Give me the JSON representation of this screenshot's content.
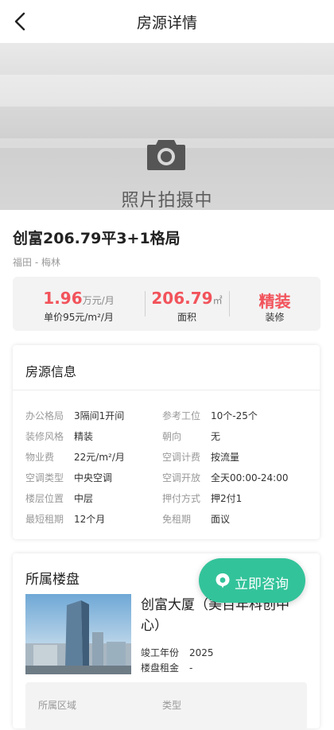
{
  "header": {
    "title": "房源详情",
    "back_icon": "chevron-left-icon"
  },
  "photo": {
    "caption": "照片拍摄中",
    "icon": "camera-icon"
  },
  "listing": {
    "title": "创富206.79平3+1格局",
    "location": "福田 - 梅林"
  },
  "stats": {
    "price_value": "1.96",
    "price_unit": "万元/月",
    "unit_price": "单价95元/m²/月",
    "area_value": "206.79",
    "area_unit": "㎡",
    "area_label": "面积",
    "decor_value": "精装",
    "decor_label": "装修",
    "accent_color": "#f2535b"
  },
  "info": {
    "title": "房源信息",
    "rows": [
      {
        "k1": "办公格局",
        "v1": "3隔间1开间",
        "k2": "参考工位",
        "v2": "10个-25个"
      },
      {
        "k1": "装修风格",
        "v1": "精装",
        "k2": "朝向",
        "v2": "无"
      },
      {
        "k1": "物业费",
        "v1": "22元/m²/月",
        "k2": "空调计费",
        "v2": "按流量"
      },
      {
        "k1": "空调类型",
        "v1": "中央空调",
        "k2": "空调开放",
        "v2": "全天00:00-24:00"
      },
      {
        "k1": "楼层位置",
        "v1": "中层",
        "k2": "押付方式",
        "v2": "押2付1"
      },
      {
        "k1": "最短租期",
        "v1": "12个月",
        "k2": "免租期",
        "v2": "面议"
      }
    ]
  },
  "building": {
    "section_title": "所属楼盘",
    "name": "创富大厦（美百年科创中心）",
    "completion_label": "竣工年份",
    "completion_value": "2025",
    "rent_label": "楼盘租金",
    "rent_value": "-",
    "district_label": "所属区域",
    "type_label": "类型"
  },
  "consult": {
    "label": "立即咨询",
    "icon": "chat-bubble-icon",
    "color": "#33c39a"
  }
}
